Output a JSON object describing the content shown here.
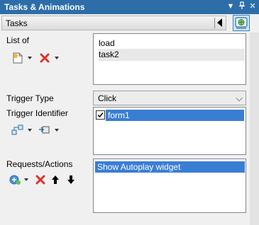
{
  "window": {
    "title": "Tasks & Animations"
  },
  "header": {
    "selected_task": "Tasks"
  },
  "icons": {
    "title_dropdown": "chevron-down-icon",
    "title_pin": "pin-icon",
    "title_close": "close-icon",
    "settings": "settings-icon"
  },
  "list_of": {
    "label": "List of",
    "items": [
      "load",
      "task2"
    ],
    "selected_index": 1
  },
  "trigger_type": {
    "label": "Trigger Type",
    "value": "Click"
  },
  "trigger_identifier": {
    "label": "Trigger Identifier",
    "items": [
      {
        "name": "form1",
        "checked": true
      }
    ]
  },
  "requests_actions": {
    "label": "Requests/Actions",
    "items": [
      "Show Autoplay widget"
    ]
  },
  "colors": {
    "title_bar": "#2d6ea8",
    "selection": "#3a7ed3",
    "panel": "#f0f0f0"
  }
}
